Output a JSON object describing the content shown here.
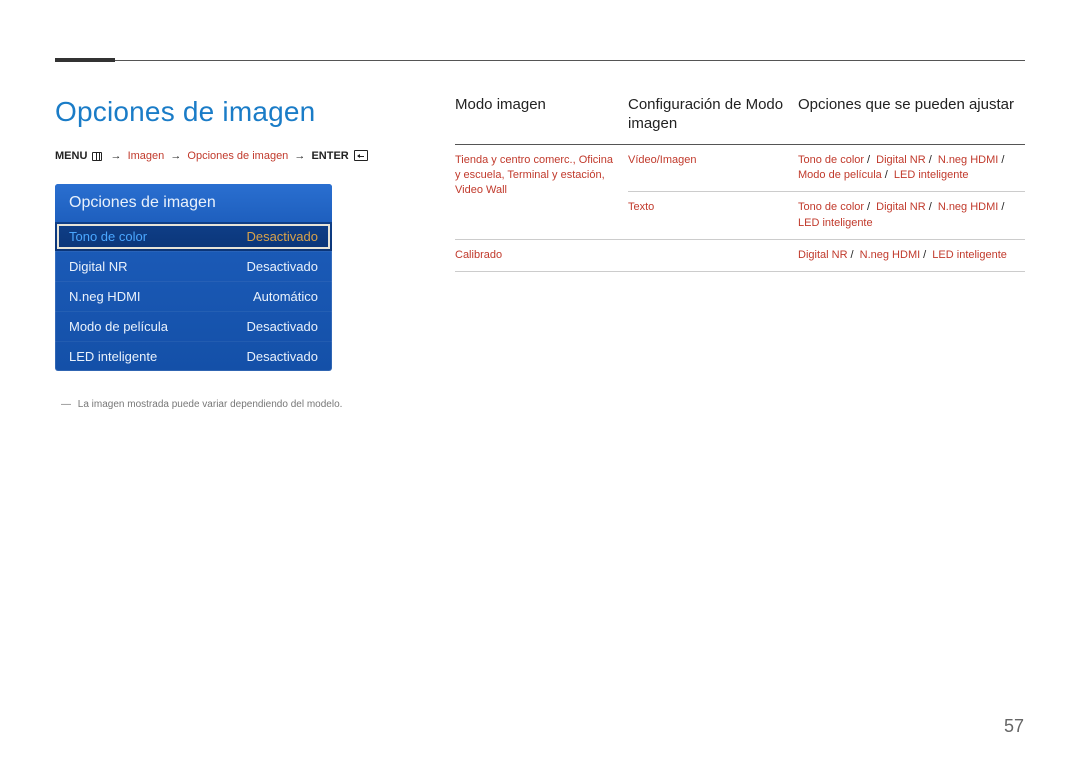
{
  "page_number": "57",
  "section_title": "Opciones de imagen",
  "breadcrumb": {
    "menu": "MENU",
    "imagen": "Imagen",
    "opciones": "Opciones de imagen",
    "enter": "ENTER"
  },
  "osd": {
    "title": "Opciones de imagen",
    "rows": [
      {
        "label": "Tono de color",
        "value": "Desactivado",
        "selected": true
      },
      {
        "label": "Digital NR",
        "value": "Desactivado",
        "selected": false
      },
      {
        "label": "N.neg HDMI",
        "value": "Automático",
        "selected": false
      },
      {
        "label": "Modo de película",
        "value": "Desactivado",
        "selected": false
      },
      {
        "label": "LED inteligente",
        "value": "Desactivado",
        "selected": false
      }
    ],
    "note_dash": "―",
    "note": "La imagen mostrada puede variar dependiendo del modelo."
  },
  "table": {
    "headers": {
      "h1": "Modo imagen",
      "h2": "Configuración de Modo imagen",
      "h3": "Opciones que se pueden ajustar"
    },
    "rows": [
      {
        "c1a": "Tienda y centro comerc.",
        "c1b": "Oficina y escuela",
        "c1c": "Terminal y estación",
        "c1d": "Video Wall",
        "c2a": "Vídeo/Imagen",
        "c3a": "Tono de color",
        "c3b": "Digital NR",
        "c3c": "N.neg HDMI",
        "c3d": "Modo de película",
        "c3e": "LED inteligente",
        "c2b": "Texto",
        "c3f": "Tono de color",
        "c3g": "Digital NR",
        "c3h": "N.neg HDMI",
        "c3i": "LED inteligente"
      },
      {
        "c1": "Calibrado",
        "c3a": "Digital NR",
        "c3b": "N.neg HDMI",
        "c3c": "LED inteligente"
      }
    ]
  }
}
